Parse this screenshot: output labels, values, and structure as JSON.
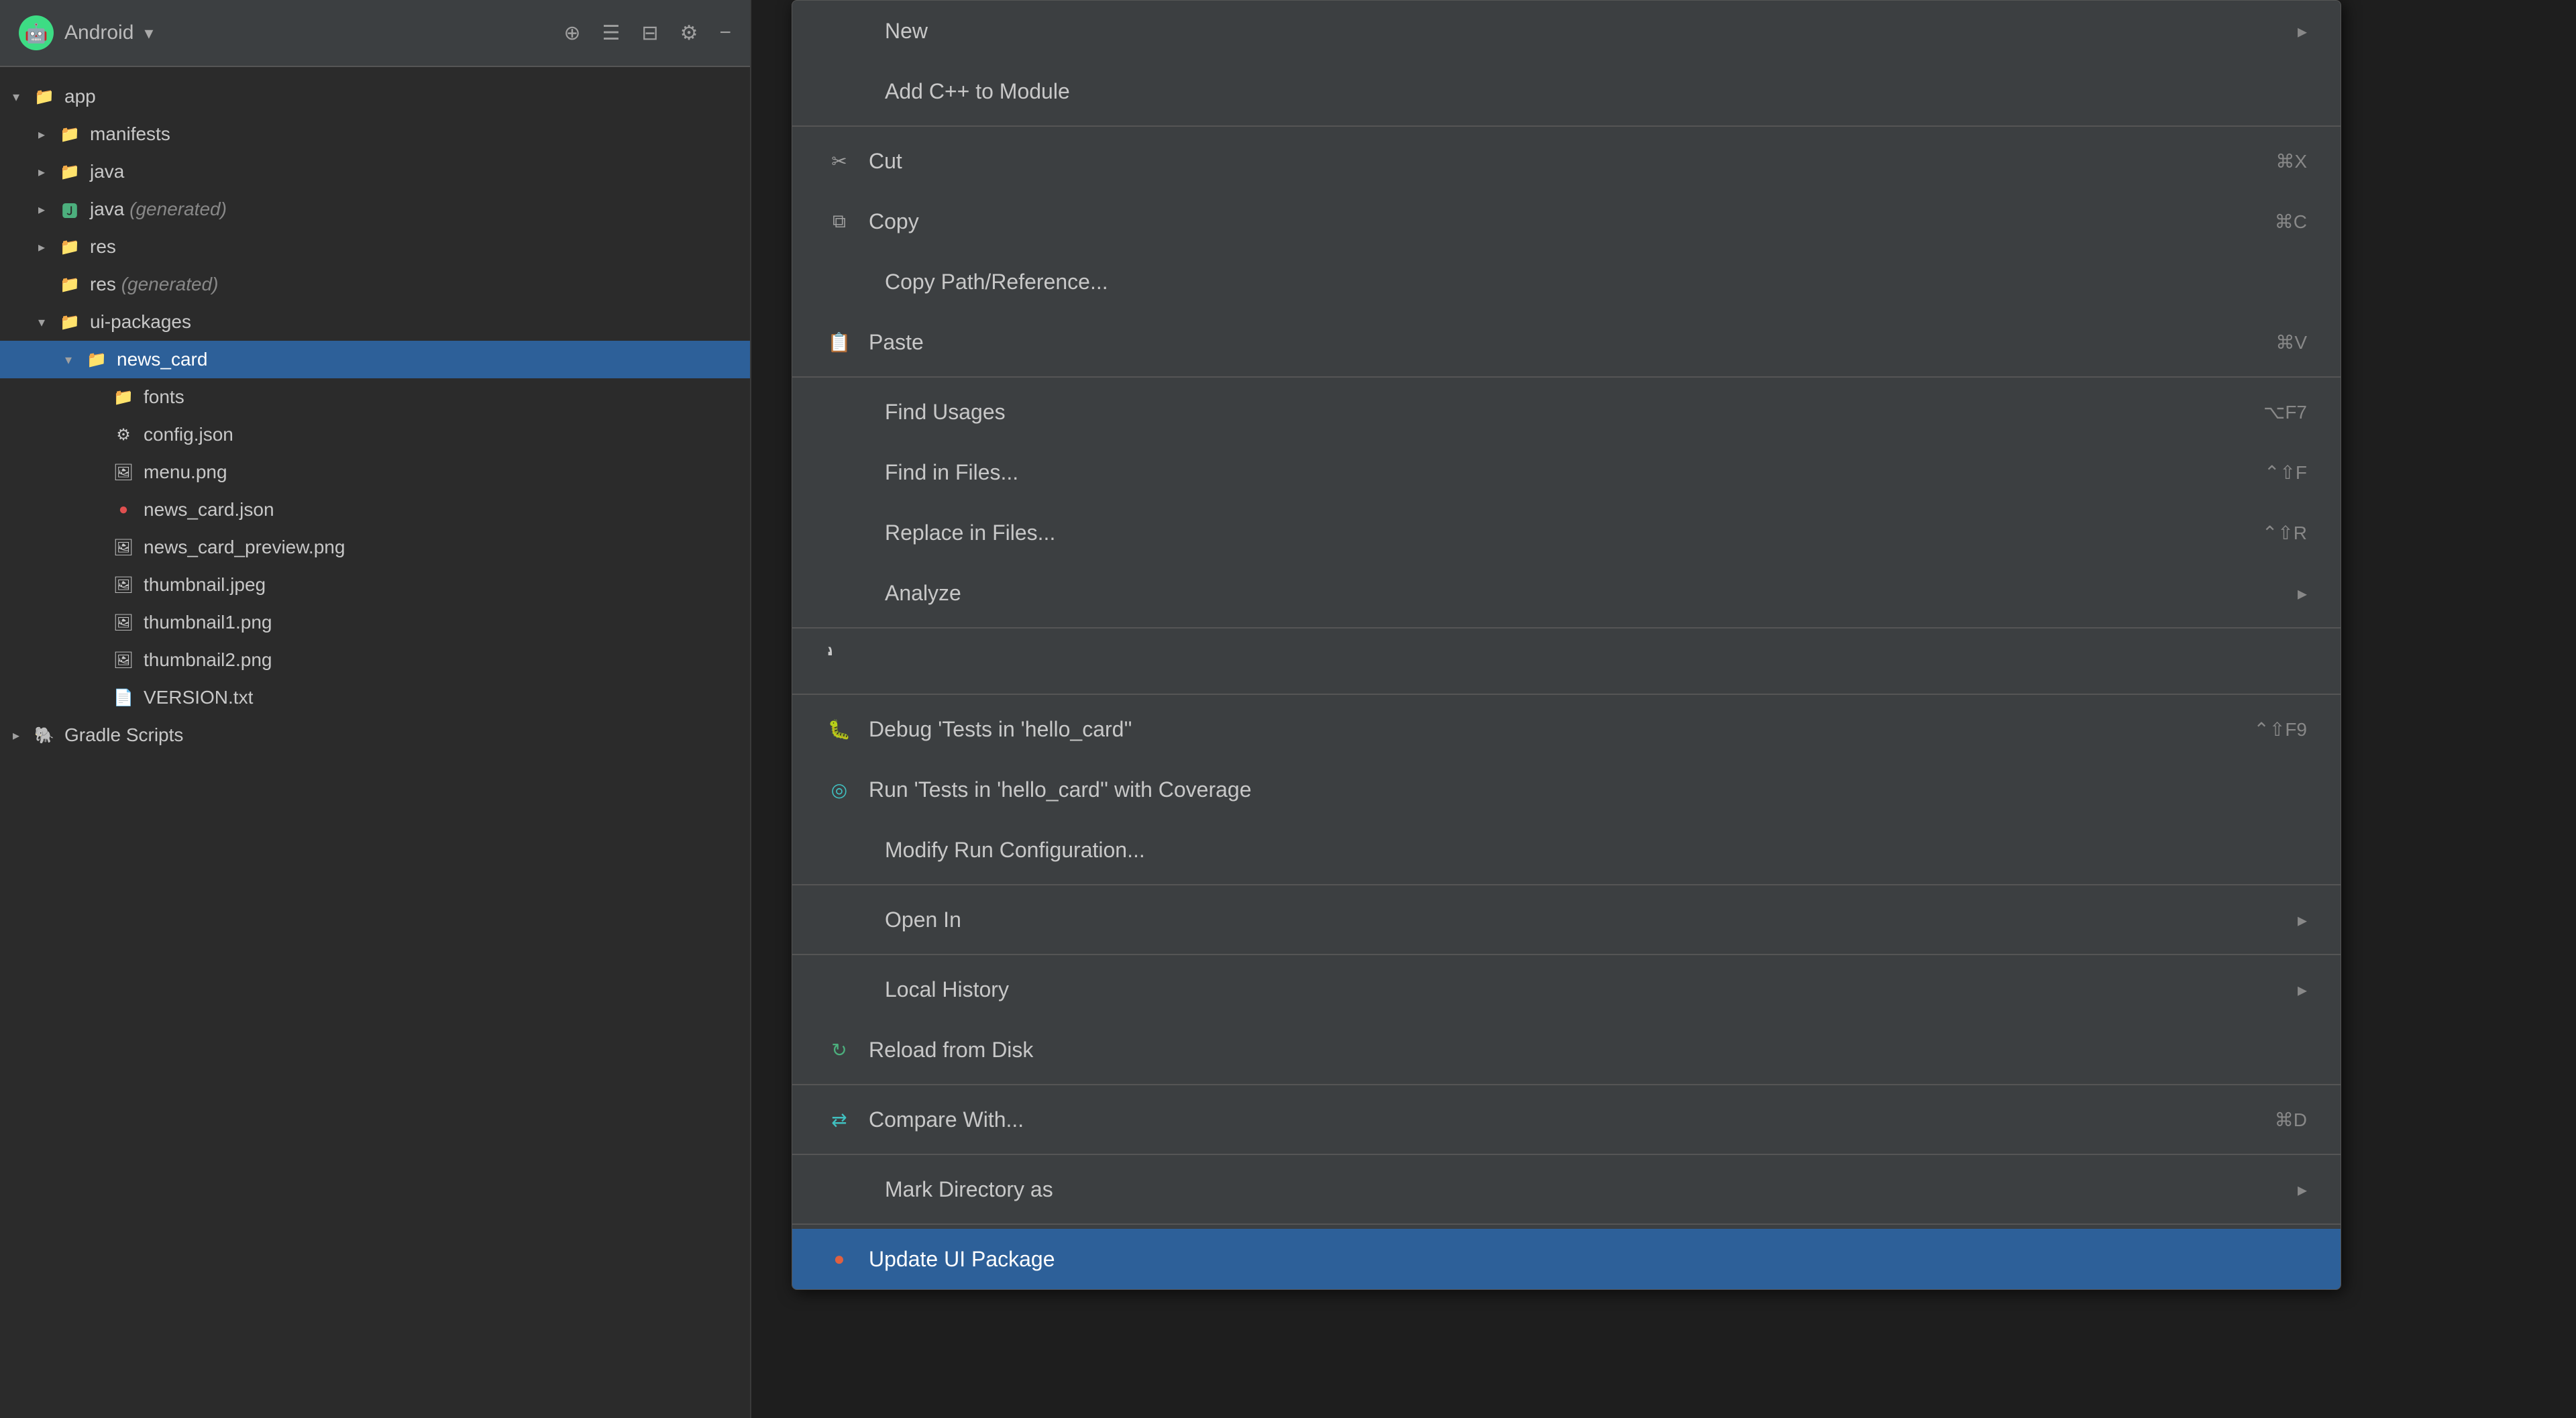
{
  "toolbar": {
    "title": "Android",
    "chevron": "▾",
    "icons": [
      "+",
      "≡",
      "≡",
      "⚙",
      "−"
    ]
  },
  "filetree": {
    "items": [
      {
        "level": 0,
        "chevron": "open",
        "icon": "folder",
        "label": "app",
        "muted": ""
      },
      {
        "level": 1,
        "chevron": "closed",
        "icon": "folder-teal",
        "label": "manifests",
        "muted": ""
      },
      {
        "level": 1,
        "chevron": "closed",
        "icon": "folder-teal",
        "label": "java",
        "muted": ""
      },
      {
        "level": 1,
        "chevron": "closed",
        "icon": "folder-java-gen",
        "label": "java",
        "muted": " (generated)"
      },
      {
        "level": 1,
        "chevron": "closed",
        "icon": "folder-teal",
        "label": "res",
        "muted": ""
      },
      {
        "level": 1,
        "chevron": "none",
        "icon": "folder-teal",
        "label": "res",
        "muted": " (generated)"
      },
      {
        "level": 1,
        "chevron": "open",
        "icon": "folder-teal",
        "label": "ui-packages",
        "muted": ""
      },
      {
        "level": 2,
        "chevron": "open",
        "icon": "folder-teal",
        "label": "news_card",
        "muted": "",
        "selected": true
      },
      {
        "level": 3,
        "chevron": "none",
        "icon": "folder",
        "label": "fonts",
        "muted": ""
      },
      {
        "level": 3,
        "chevron": "none",
        "icon": "file-config",
        "label": "config.json",
        "muted": ""
      },
      {
        "level": 3,
        "chevron": "none",
        "icon": "file-png",
        "label": "menu.png",
        "muted": ""
      },
      {
        "level": 3,
        "chevron": "none",
        "icon": "file-red",
        "label": "news_card.json",
        "muted": ""
      },
      {
        "level": 3,
        "chevron": "none",
        "icon": "file-png",
        "label": "news_card_preview.png",
        "muted": ""
      },
      {
        "level": 3,
        "chevron": "none",
        "icon": "file-png",
        "label": "thumbnail.jpeg",
        "muted": ""
      },
      {
        "level": 3,
        "chevron": "none",
        "icon": "file-png",
        "label": "thumbnail1.png",
        "muted": ""
      },
      {
        "level": 3,
        "chevron": "none",
        "icon": "file-png",
        "label": "thumbnail2.png",
        "muted": ""
      },
      {
        "level": 3,
        "chevron": "none",
        "icon": "file-txt",
        "label": "VERSION.txt",
        "muted": ""
      },
      {
        "level": 0,
        "chevron": "closed",
        "icon": "gradle",
        "label": "Gradle Scripts",
        "muted": ""
      }
    ]
  },
  "contextmenu": {
    "items": [
      {
        "type": "item",
        "icon": "none",
        "label": "New",
        "shortcut": "",
        "arrow": true,
        "selected": false
      },
      {
        "type": "item",
        "icon": "none",
        "label": "Add C++ to Module",
        "shortcut": "",
        "arrow": false,
        "selected": false
      },
      {
        "type": "separator"
      },
      {
        "type": "item",
        "icon": "cut",
        "label": "Cut",
        "shortcut": "⌘X",
        "arrow": false,
        "selected": false
      },
      {
        "type": "item",
        "icon": "copy",
        "label": "Copy",
        "shortcut": "⌘C",
        "arrow": false,
        "selected": false
      },
      {
        "type": "item",
        "icon": "none",
        "label": "Copy Path/Reference...",
        "shortcut": "",
        "arrow": false,
        "selected": false
      },
      {
        "type": "item",
        "icon": "paste",
        "label": "Paste",
        "shortcut": "⌘V",
        "arrow": false,
        "selected": false
      },
      {
        "type": "separator"
      },
      {
        "type": "item",
        "icon": "none",
        "label": "Find Usages",
        "shortcut": "⌥F7",
        "arrow": false,
        "selected": false
      },
      {
        "type": "item",
        "icon": "none",
        "label": "Find in Files...",
        "shortcut": "⌃⇧F",
        "arrow": false,
        "selected": false
      },
      {
        "type": "item",
        "icon": "none",
        "label": "Replace in Files...",
        "shortcut": "⌃⇧R",
        "arrow": false,
        "selected": false
      },
      {
        "type": "item",
        "icon": "none",
        "label": "Analyze",
        "shortcut": "",
        "arrow": true,
        "selected": false
      },
      {
        "type": "separator"
      },
      {
        "type": "spinner"
      },
      {
        "type": "separator"
      },
      {
        "type": "item",
        "icon": "debug-green",
        "label": "Debug 'Tests in 'hello_card''",
        "shortcut": "⌃⇧F9",
        "arrow": false,
        "selected": false
      },
      {
        "type": "item",
        "icon": "coverage-cyan",
        "label": "Run 'Tests in 'hello_card'' with Coverage",
        "shortcut": "",
        "arrow": false,
        "selected": false
      },
      {
        "type": "item",
        "icon": "none",
        "label": "Modify Run Configuration...",
        "shortcut": "",
        "arrow": false,
        "selected": false
      },
      {
        "type": "separator"
      },
      {
        "type": "item",
        "icon": "none",
        "label": "Open In",
        "shortcut": "",
        "arrow": true,
        "selected": false
      },
      {
        "type": "separator"
      },
      {
        "type": "item",
        "icon": "none",
        "label": "Local History",
        "shortcut": "",
        "arrow": true,
        "selected": false
      },
      {
        "type": "item",
        "icon": "reload-green",
        "label": "Reload from Disk",
        "shortcut": "",
        "arrow": false,
        "selected": false
      },
      {
        "type": "separator"
      },
      {
        "type": "item",
        "icon": "compare-cyan",
        "label": "Compare With...",
        "shortcut": "⌘D",
        "arrow": false,
        "selected": false
      },
      {
        "type": "separator"
      },
      {
        "type": "item",
        "icon": "none",
        "label": "Mark Directory as",
        "shortcut": "",
        "arrow": true,
        "selected": false
      },
      {
        "type": "separator"
      },
      {
        "type": "item",
        "icon": "update-orange",
        "label": "Update UI Package",
        "shortcut": "",
        "arrow": false,
        "selected": true
      }
    ]
  }
}
